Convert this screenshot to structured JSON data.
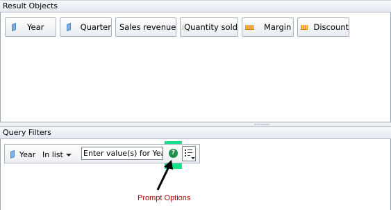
{
  "result_panel": {
    "title": "Result Objects",
    "objects": [
      {
        "label": "Year",
        "kind": "dimension"
      },
      {
        "label": "Quarter",
        "kind": "dimension"
      },
      {
        "label": "Sales revenue",
        "kind": "measure"
      },
      {
        "label": "Quantity sold",
        "kind": "measure"
      },
      {
        "label": "Margin",
        "kind": "measure"
      },
      {
        "label": "Discount",
        "kind": "measure"
      }
    ]
  },
  "filter_panel": {
    "title": "Query Filters",
    "filter": {
      "object": "Year",
      "operator": "In list",
      "prompt_text": "Enter value(s) for Year:"
    }
  },
  "annotation": {
    "label": "Prompt Options",
    "color": "#b30000"
  },
  "icons": {
    "dimension": "dimension-icon",
    "measure": "measure-icon",
    "prompt": "prompt-options-icon",
    "list": "value-list-icon"
  },
  "colors": {
    "highlight": "#18e08a"
  }
}
